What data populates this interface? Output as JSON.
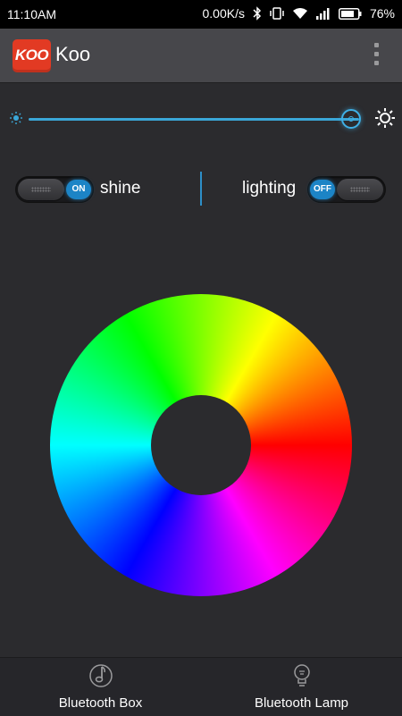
{
  "status_bar": {
    "time": "11:10AM",
    "network_speed": "0.00K/s",
    "battery": "76%",
    "icons": [
      "bluetooth-icon",
      "vibrate-icon",
      "wifi-icon",
      "signal-icon",
      "battery-icon"
    ]
  },
  "app_bar": {
    "logo_text": "KOO",
    "title": "Koo",
    "menu_icon": "overflow-menu-icon"
  },
  "brightness": {
    "min_icon": "sun-small-icon",
    "max_icon": "sun-large-icon",
    "level": 0.99
  },
  "controls": {
    "shine": {
      "label": "shine",
      "state": "ON"
    },
    "lighting": {
      "label": "lighting",
      "state": "OFF"
    }
  },
  "color_picker": {
    "type": "hue-wheel"
  },
  "bottom_nav": {
    "items": [
      {
        "label": "Bluetooth Box",
        "icon": "music-note-icon"
      },
      {
        "label": "Bluetooth Lamp",
        "icon": "lightbulb-icon"
      }
    ]
  },
  "colors": {
    "accent": "#3aa7d8",
    "toggle_active": "#1c84c6",
    "logo": "#e23a23",
    "background": "#2b2b2e",
    "app_bar": "#47474b"
  }
}
